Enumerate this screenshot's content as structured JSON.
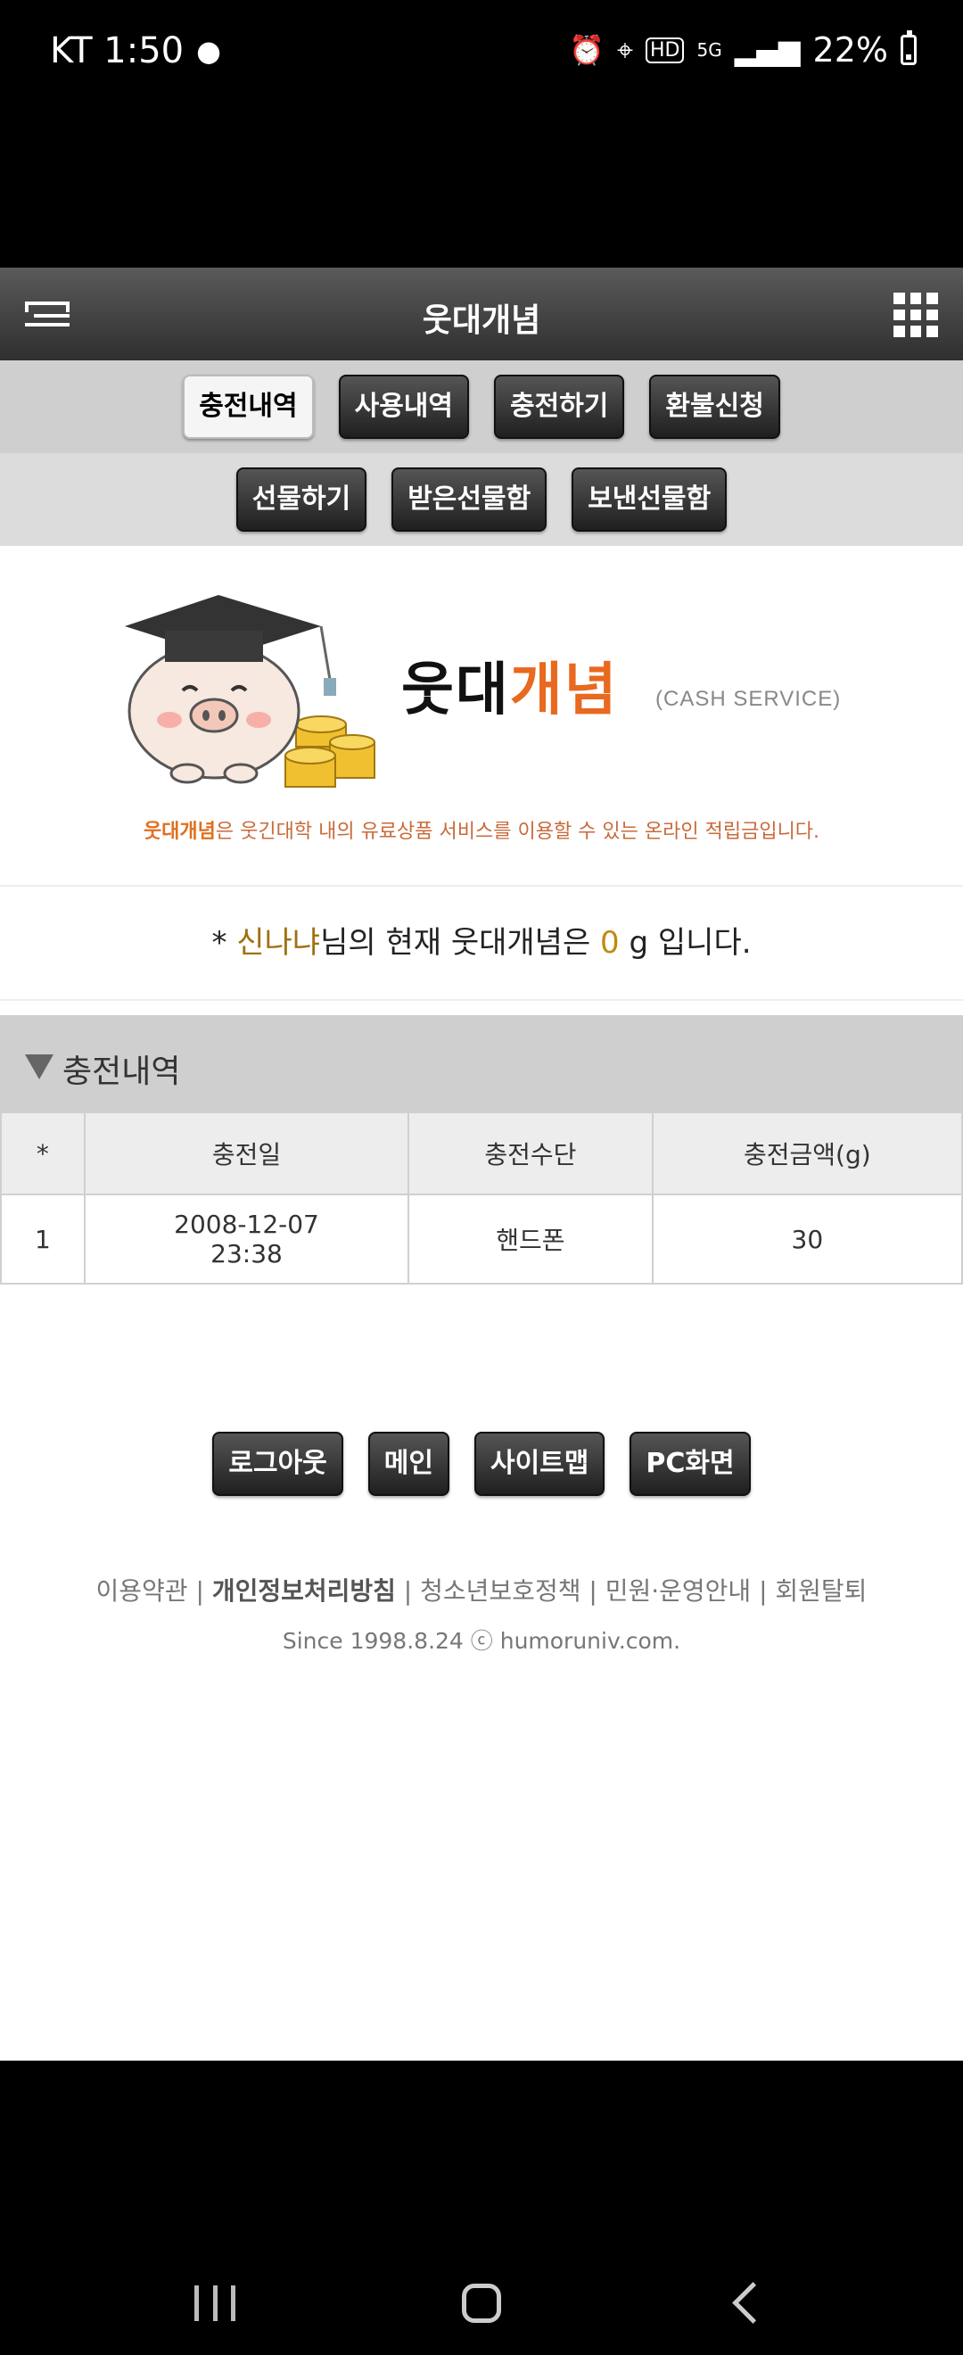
{
  "status": {
    "carrier_time": "KT 1:50",
    "battery": "22%"
  },
  "header": {
    "title": "웃대개념"
  },
  "tabs_row1": [
    "충전내역",
    "사용내역",
    "충전하기",
    "환불신청"
  ],
  "tabs_row2": [
    "선물하기",
    "받은선물함",
    "보낸선물함"
  ],
  "banner": {
    "brand_part1": "웃대",
    "brand_part2": "개념",
    "tagline": "(CASH SERVICE)",
    "desc_highlight": "웃대개념",
    "desc_rest": "은 웃긴대학 내의 유료상품 서비스를 이용할 수 있는 온라인 적립금입니다."
  },
  "balance": {
    "prefix": "* ",
    "nickname": "신나냐",
    "mid": "님의 현재 웃대개념은 ",
    "amount": "0",
    "suffix": " g 입니다."
  },
  "section": {
    "title": "충전내역"
  },
  "table": {
    "headers": [
      "*",
      "충전일",
      "충전수단",
      "충전금액(g)"
    ],
    "rows": [
      {
        "no": "1",
        "date": "2008-12-07",
        "time": "23:38",
        "method": "핸드폰",
        "amount": "30"
      }
    ]
  },
  "footer": {
    "buttons": [
      "로그아웃",
      "메인",
      "사이트맵",
      "PC화면"
    ],
    "links": [
      "이용약관",
      "개인정보처리방침",
      "청소년보호정책",
      "민원·운영안내",
      "회원탈퇴"
    ],
    "since": "Since 1998.8.24 ⓒ humoruniv.com."
  },
  "colors": {
    "accent_orange": "#e8691f",
    "nickname": "#a07010"
  }
}
